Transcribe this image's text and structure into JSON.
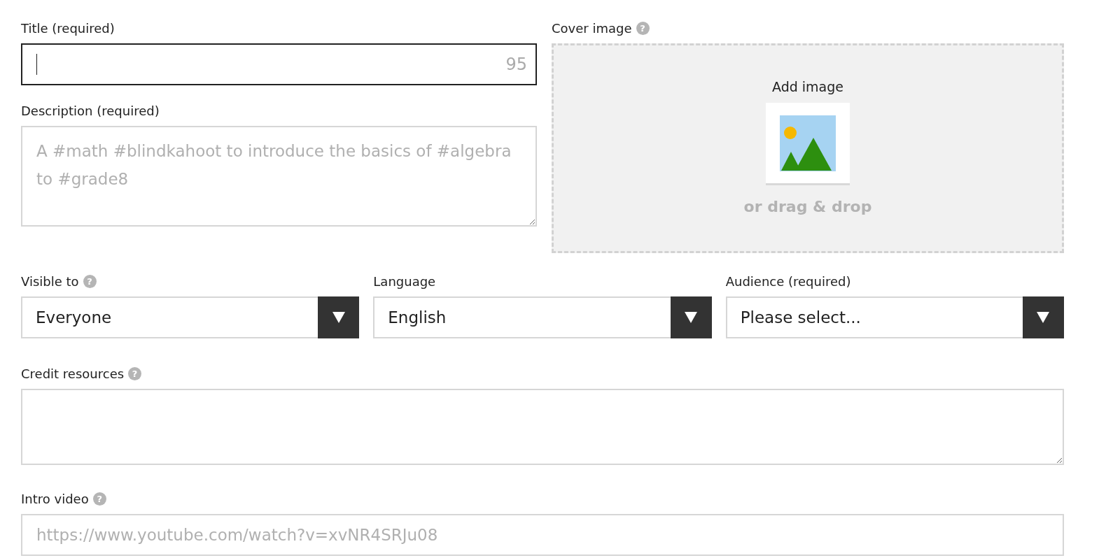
{
  "title_field": {
    "label": "Title (required)",
    "counter": "95",
    "focused": true
  },
  "description_field": {
    "label": "Description (required)",
    "placeholder": "A #math #blindkahoot to introduce the basics of #algebra to #grade8"
  },
  "cover_image": {
    "label": "Cover image",
    "help": "?",
    "button": "Add image",
    "hint": "or drag & drop"
  },
  "selects": [
    {
      "label": "Visible to",
      "help": "?",
      "value": "Everyone"
    },
    {
      "label": "Language",
      "value": "English"
    },
    {
      "label": "Audience (required)",
      "value": "Please select..."
    }
  ],
  "credit_field": {
    "label": "Credit resources",
    "help": "?"
  },
  "intro_video": {
    "label": "Intro video",
    "help": "?",
    "placeholder": "https://www.youtube.com/watch?v=xvNR4SRJu08"
  }
}
